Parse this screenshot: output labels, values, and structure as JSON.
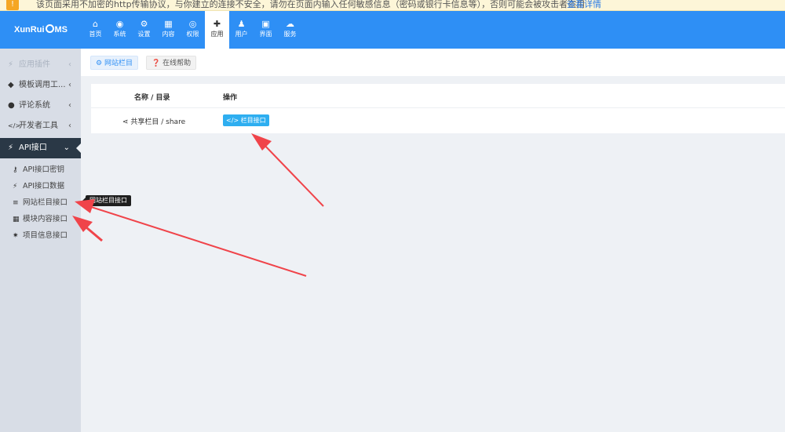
{
  "warning": {
    "text": "该页面采用不加密的http传输协议，与你建立的连接不安全，请勿在页面内输入任何敏感信息（密码或银行卡信息等），否则可能会被攻击者盗用",
    "link": "查看详情"
  },
  "header": {
    "logo_left": "XunRui",
    "logo_right": "MS",
    "nav": [
      {
        "label": "首页",
        "icon": "home-icon",
        "glyph": "⌂"
      },
      {
        "label": "系统",
        "icon": "globe-icon",
        "glyph": "◉"
      },
      {
        "label": "设置",
        "icon": "cogs-icon",
        "glyph": "⚙"
      },
      {
        "label": "内容",
        "icon": "grid-icon",
        "glyph": "▦"
      },
      {
        "label": "权限",
        "icon": "user-circle-icon",
        "glyph": "◎"
      },
      {
        "label": "应用",
        "icon": "puzzle-icon",
        "glyph": "✚"
      },
      {
        "label": "用户",
        "icon": "user-icon",
        "glyph": "♟"
      },
      {
        "label": "界面",
        "icon": "html5-icon",
        "glyph": "▣"
      },
      {
        "label": "服务",
        "icon": "cloud-icon",
        "glyph": "☁"
      }
    ],
    "active_nav": "应用"
  },
  "sidebar": {
    "items": [
      {
        "label": "应用插件",
        "icon": "plug-icon",
        "glyph": "⚡"
      },
      {
        "label": "模板调用工...",
        "icon": "tag-icon",
        "glyph": "◆"
      },
      {
        "label": "评论系统",
        "icon": "comments-icon",
        "glyph": "●"
      },
      {
        "label": "开发者工具",
        "icon": "code-icon",
        "glyph": "</>"
      },
      {
        "label": "API接口",
        "icon": "plug-icon",
        "glyph": "⚡"
      }
    ],
    "subitems": [
      {
        "label": "API接口密钥",
        "icon": "key-icon",
        "glyph": "⚷"
      },
      {
        "label": "API接口数据",
        "icon": "plug-icon",
        "glyph": "⚡"
      },
      {
        "label": "网站栏目接口",
        "icon": "list-icon",
        "glyph": "≡"
      },
      {
        "label": "模块内容接口",
        "icon": "th-large-icon",
        "glyph": "▦"
      },
      {
        "label": "项目信息接口",
        "icon": "gear-icon",
        "glyph": "✷"
      }
    ],
    "tooltip": "网站栏目接口"
  },
  "tabs": {
    "active": "网站栏目",
    "help": "在线帮助"
  },
  "table": {
    "columns": [
      "名称 / 目录",
      "操作"
    ],
    "rows": [
      {
        "name": "共享栏目 / share",
        "action": "栏目接口"
      }
    ]
  },
  "colors": {
    "header": "#2e8ff5",
    "sidebar": "#d8dde6",
    "active_item": "#2a3846",
    "button": "#2eaef0",
    "arrow": "#f0444a"
  }
}
